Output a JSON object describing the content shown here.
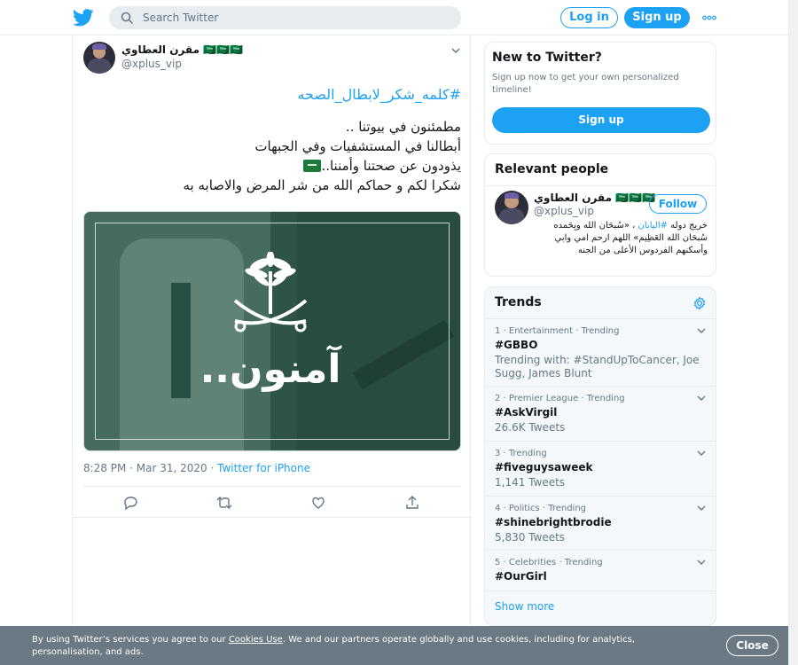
{
  "topbar": {
    "logo_icon": "twitter-bird-icon",
    "search_placeholder": "Search Twitter",
    "login_label": "Log in",
    "signup_label": "Sign up",
    "more_icon": "more-dots-icon"
  },
  "tweet": {
    "author_name": "مقرن العطاوي 🇸🇦🇸🇦🇸🇦",
    "author_handle": "@xplus_vip",
    "hashtag": "#كلمه_شكر_لابطال_الصحه",
    "lines": [
      "مطمئنون في بيوتنا ..",
      "أبطالنا في المستشفيات وفي الجبهات",
      "يذودون عن صحتنا وأمننا..",
      "شكرا لكم و حماكم الله من شر المرض والاصابه به"
    ],
    "media_caption": "آمنون..",
    "timestamp": "8:28 PM · Mar 31, 2020",
    "separator": " · ",
    "source": "Twitter for iPhone",
    "actions": [
      "reply-icon",
      "retweet-icon",
      "like-icon",
      "share-icon"
    ]
  },
  "sidebar": {
    "new_to_twitter": {
      "title": "New to Twitter?",
      "description": "Sign up now to get your own personalized timeline!",
      "button": "Sign up"
    },
    "relevant_people": {
      "title": "Relevant people",
      "name": "مقرن العطاوي 🇸🇦🇸🇦🇸🇦",
      "handle": "@xplus_vip",
      "follow_label": "Follow",
      "bio_pre": "خريج دوله ",
      "bio_link": "#اليابان",
      "bio_post": " ، «سُبحَان الله وبِحَمده سُبحَان الله العَظِيم» اللهم ارحم امي وابي وأسكنهم الفردوس الأعلى من الجنه"
    },
    "trends": {
      "title": "Trends",
      "items": [
        {
          "meta": "1 · Entertainment · Trending",
          "name": "#GBBO",
          "stat": "Trending with: #StandUpToCancer, Joe Sugg, James Blunt"
        },
        {
          "meta": "2 · Premier League · Trending",
          "name": "#AskVirgil",
          "stat": "26.6K Tweets"
        },
        {
          "meta": "3 · Trending",
          "name": "#fiveguysaweek",
          "stat": "1,141 Tweets"
        },
        {
          "meta": "4 · Politics · Trending",
          "name": "#shinebrightbrodie",
          "stat": "5,830 Tweets"
        },
        {
          "meta": "5 · Celebrities · Trending",
          "name": "#OurGirl",
          "stat": ""
        }
      ],
      "show_more": "Show more"
    }
  },
  "cookie": {
    "text_before": "By using Twitter’s services you agree to our ",
    "link": "Cookies Use",
    "text_after": ". We and our partners operate globally and use cookies, including for analytics, personalisation, and ads.",
    "close_label": "Close"
  },
  "colors": {
    "brand": "#1da1f2",
    "text": "#14171a",
    "muted": "#657786",
    "border": "#e6ecf0",
    "cookie_bg": "#66757f"
  }
}
